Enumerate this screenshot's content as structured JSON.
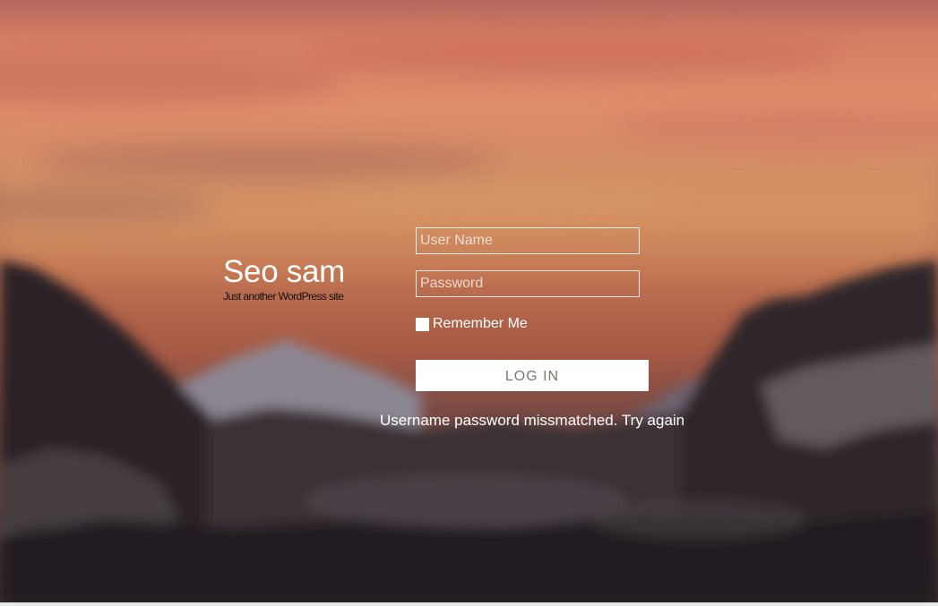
{
  "site": {
    "title": "Seo sam",
    "tagline": "Just another WordPress site"
  },
  "login_form": {
    "username_placeholder": "User Name",
    "username_value": "",
    "password_placeholder": "Password",
    "password_value": "",
    "remember_label": "Remember Me",
    "remember_checked": false,
    "submit_label": "LOG IN",
    "error_message": "Username password missmatched. Try again"
  },
  "background": {
    "description_icon": "blurred-sunset-mountains-image"
  },
  "colors": {
    "button_bg": "#ffffff",
    "button_text": "#7d7770",
    "text": "#ffffff",
    "tagline_text": "#111111"
  }
}
